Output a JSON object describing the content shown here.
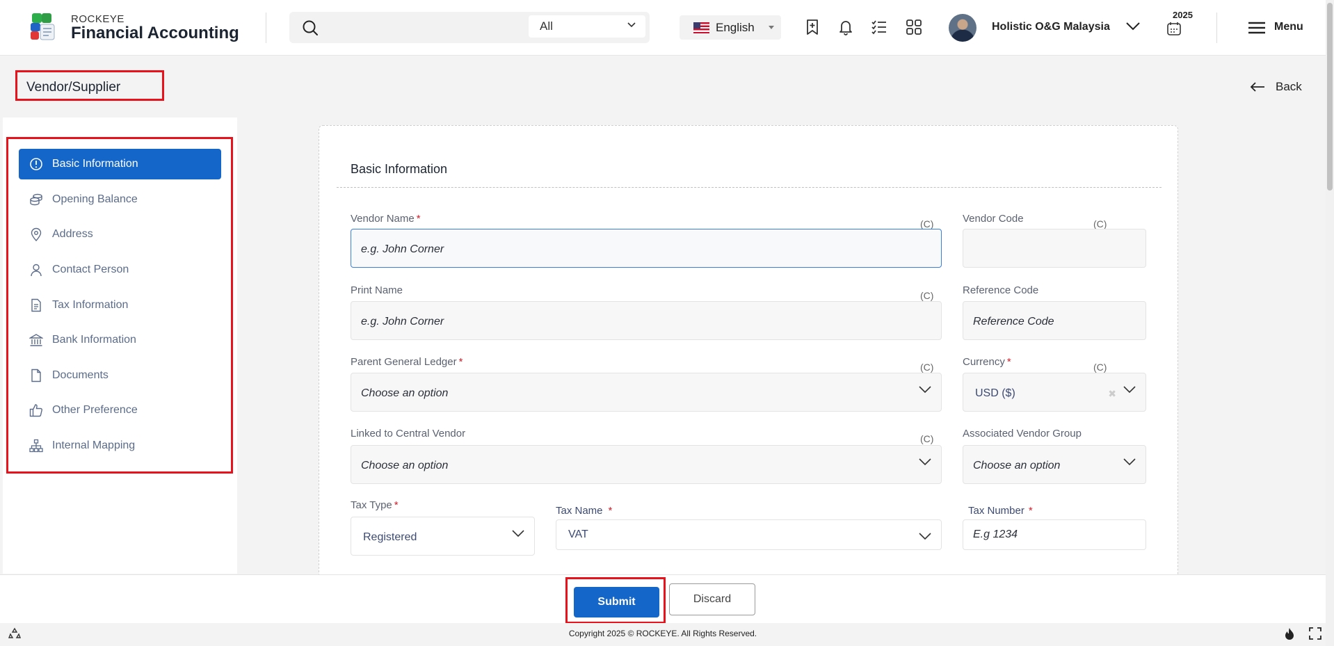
{
  "header": {
    "brand_top": "ROCKEYE",
    "brand_name": "Financial Accounting",
    "search_scope": "All",
    "language": "English",
    "company": "Holistic O&G Malaysia",
    "year": "2025",
    "menu_label": "Menu"
  },
  "page": {
    "title": "Vendor/Supplier",
    "back_label": "Back"
  },
  "sidebar": {
    "items": [
      {
        "label": "Basic Information",
        "icon": "info-circle-icon",
        "active": true
      },
      {
        "label": "Opening Balance",
        "icon": "coins-icon",
        "active": false
      },
      {
        "label": "Address",
        "icon": "map-pin-icon",
        "active": false
      },
      {
        "label": "Contact Person",
        "icon": "user-icon",
        "active": false
      },
      {
        "label": "Tax Information",
        "icon": "document-lines-icon",
        "active": false
      },
      {
        "label": "Bank Information",
        "icon": "bank-icon",
        "active": false
      },
      {
        "label": "Documents",
        "icon": "file-icon",
        "active": false
      },
      {
        "label": "Other Preference",
        "icon": "thumbs-up-icon",
        "active": false
      },
      {
        "label": "Internal Mapping",
        "icon": "hierarchy-icon",
        "active": false
      }
    ]
  },
  "form": {
    "section_title": "Basic Information",
    "c_tag": "(C)",
    "vendor_name": {
      "label": "Vendor Name",
      "required": "*",
      "placeholder": "e.g. John Corner"
    },
    "vendor_code": {
      "label": "Vendor Code",
      "value": ""
    },
    "print_name": {
      "label": "Print Name",
      "placeholder": "e.g. John Corner"
    },
    "reference_code": {
      "label": "Reference Code",
      "placeholder": "Reference Code"
    },
    "parent_gl": {
      "label": "Parent General Ledger",
      "required": "*",
      "placeholder": "Choose an option"
    },
    "currency": {
      "label": "Currency",
      "required": "*",
      "value": "USD ($)",
      "clear": "✖"
    },
    "linked_central_vendor": {
      "label": "Linked to Central Vendor",
      "placeholder": "Choose an option"
    },
    "associated_vendor_group": {
      "label": "Associated Vendor Group",
      "placeholder": "Choose an option"
    },
    "tax_type": {
      "label": "Tax Type",
      "required": "*",
      "value": "Registered"
    },
    "tax_name": {
      "label": "Tax Name",
      "required": "*",
      "value": "VAT"
    },
    "tax_number": {
      "label": "Tax Number",
      "required": "*",
      "placeholder": "E.g 1234"
    }
  },
  "actions": {
    "submit_label": "Submit",
    "discard_label": "Discard"
  },
  "footer": {
    "copyright": "Copyright 2025 © ROCKEYE. All Rights Reserved."
  },
  "colors": {
    "primary": "#1466c9",
    "highlight_border": "#e8121d",
    "sidebar_text": "#5b6c8a",
    "required": "#d3202b"
  }
}
